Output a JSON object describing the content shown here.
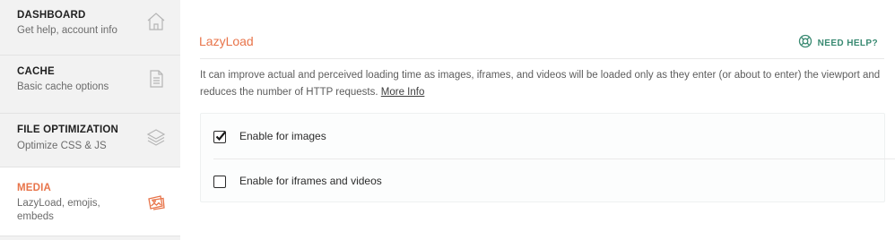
{
  "sidebar": {
    "items": [
      {
        "title": "DASHBOARD",
        "subtitle": "Get help, account info",
        "icon": "house-icon"
      },
      {
        "title": "CACHE",
        "subtitle": "Basic cache options",
        "icon": "document-icon"
      },
      {
        "title": "FILE OPTIMIZATION",
        "subtitle": "Optimize CSS & JS",
        "icon": "layers-icon"
      },
      {
        "title": "MEDIA",
        "subtitle_line1": "LazyLoad, emojis,",
        "subtitle_line2": "embeds",
        "icon": "images-icon",
        "active": true
      }
    ]
  },
  "main": {
    "section_title": "LazyLoad",
    "need_help_label": "NEED HELP?",
    "description": "It can improve actual and perceived loading time as images, iframes, and videos will be loaded only as they enter (or about to enter) the viewport and reduces the number of HTTP requests.",
    "more_info": "More Info",
    "options": [
      {
        "label": "Enable for images",
        "checked": true
      },
      {
        "label": "Enable for iframes and videos",
        "checked": false
      }
    ]
  },
  "colors": {
    "accent": "#e8744a",
    "help_green": "#3a8a72",
    "sidebar_bg": "#f2f2f2"
  }
}
